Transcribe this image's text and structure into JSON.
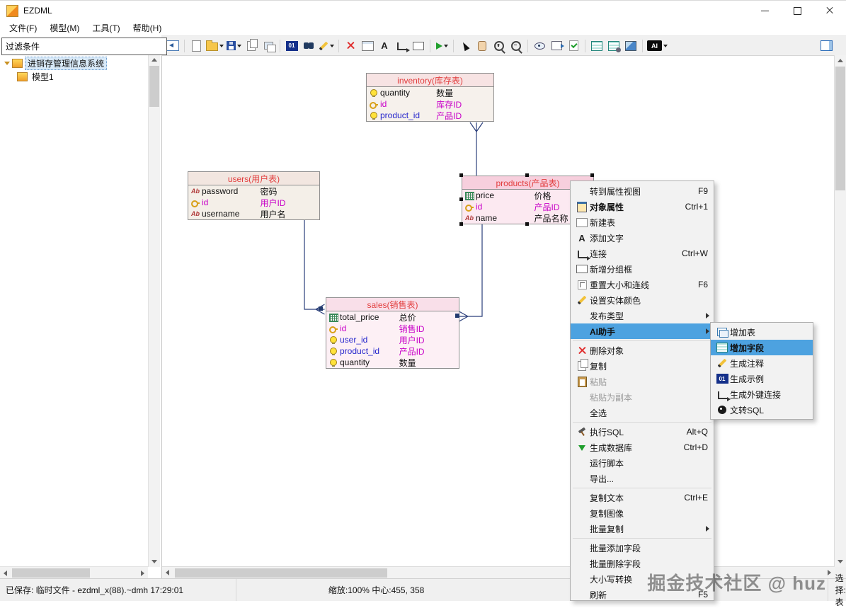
{
  "window": {
    "title": "EZDML"
  },
  "menubar": {
    "items": [
      "文件(F)",
      "模型(M)",
      "工具(T)",
      "帮助(H)"
    ]
  },
  "glyphs": {
    "binary": "01",
    "text_a": "A",
    "ai": "AI",
    "abc": "Ab"
  },
  "toolbar": {
    "icons": [
      "previous-diagram",
      "new-model",
      "open-model",
      "save-model",
      "copy-model",
      "cascade-windows",
      "binary-data",
      "find",
      "edit-color",
      "delete-selected",
      "new-table",
      "add-text",
      "add-connection",
      "add-group-box",
      "run",
      "select-pointer",
      "pan-hand",
      "zoom-in",
      "zoom-out",
      "preview",
      "export-model",
      "check-script",
      "model-grid",
      "model-grid-settings",
      "diagram-image",
      "ai-assistant",
      "panel-layout"
    ]
  },
  "sidebar": {
    "filter_value": "过滤条件",
    "tree_items": [
      "进销存管理信息系统",
      "模型1"
    ]
  },
  "diagram": {
    "tables": [
      {
        "title": "inventory(库存表)",
        "fields": [
          {
            "name": "quantity",
            "label": "数量",
            "icon": "bulb"
          },
          {
            "name": "id",
            "label": "库存ID",
            "icon": "key"
          },
          {
            "name": "product_id",
            "label": "产品ID",
            "icon": "bulb"
          }
        ]
      },
      {
        "title": "users(用户表)",
        "fields": [
          {
            "name": "password",
            "label": "密码",
            "icon": "abc"
          },
          {
            "name": "id",
            "label": "用户ID",
            "icon": "key"
          },
          {
            "name": "username",
            "label": "用户名",
            "icon": "abc"
          }
        ]
      },
      {
        "title": "products(产品表)",
        "fields": [
          {
            "name": "price",
            "label": "价格",
            "icon": "numeric"
          },
          {
            "name": "id",
            "label": "产品ID",
            "icon": "key"
          },
          {
            "name": "name",
            "label": "产品名称",
            "icon": "abc"
          }
        ]
      },
      {
        "title": "sales(销售表)",
        "fields": [
          {
            "name": "total_price",
            "label": "总价",
            "icon": "numeric"
          },
          {
            "name": "id",
            "label": "销售ID",
            "icon": "key"
          },
          {
            "name": "user_id",
            "label": "用户ID",
            "icon": "bulb"
          },
          {
            "name": "product_id",
            "label": "产品ID",
            "icon": "bulb"
          },
          {
            "name": "quantity",
            "label": "数量",
            "icon": "bulb"
          }
        ]
      }
    ]
  },
  "context_menu": {
    "items": [
      {
        "label": "转到属性视图",
        "shortcut": "F9"
      },
      {
        "label": "对象属性",
        "shortcut": "Ctrl+1"
      },
      {
        "label": "新建表",
        "shortcut": ""
      },
      {
        "label": "添加文字",
        "shortcut": ""
      },
      {
        "label": "连接",
        "shortcut": "Ctrl+W"
      },
      {
        "label": "新增分组框",
        "shortcut": ""
      },
      {
        "label": "重置大小和连线",
        "shortcut": "F6"
      },
      {
        "label": "设置实体颜色",
        "shortcut": ""
      },
      {
        "label": "发布类型",
        "shortcut": ""
      },
      {
        "label": "AI助手",
        "shortcut": ""
      },
      {
        "label": "删除对象",
        "shortcut": ""
      },
      {
        "label": "复制",
        "shortcut": ""
      },
      {
        "label": "粘贴",
        "shortcut": ""
      },
      {
        "label": "粘贴为副本",
        "shortcut": ""
      },
      {
        "label": "全选",
        "shortcut": ""
      },
      {
        "label": "执行SQL",
        "shortcut": "Alt+Q"
      },
      {
        "label": "生成数据库",
        "shortcut": "Ctrl+D"
      },
      {
        "label": "运行脚本",
        "shortcut": ""
      },
      {
        "label": "导出...",
        "shortcut": ""
      },
      {
        "label": "复制文本",
        "shortcut": "Ctrl+E"
      },
      {
        "label": "复制图像",
        "shortcut": ""
      },
      {
        "label": "批量复制",
        "shortcut": ""
      },
      {
        "label": "批量添加字段",
        "shortcut": ""
      },
      {
        "label": "批量删除字段",
        "shortcut": ""
      },
      {
        "label": "大小写转换",
        "shortcut": ""
      },
      {
        "label": "刷新",
        "shortcut": "F5"
      }
    ]
  },
  "ai_submenu": {
    "items": [
      {
        "label": "增加表"
      },
      {
        "label": "增加字段"
      },
      {
        "label": "生成注释"
      },
      {
        "label": "生成示例"
      },
      {
        "label": "生成外键连接"
      },
      {
        "label": "文转SQL"
      }
    ]
  },
  "statusbar": {
    "save_status": "已保存: 临时文件 - ezdml_x(88).~dmh 17:29:01",
    "zoom_center": "缩放:100% 中心:455, 358",
    "selection": "选择: 表"
  },
  "watermark": "掘金技术社区 @ huz",
  "colors": {
    "menu_highlight": "#4da2e0",
    "table_title": "#e23d3d",
    "primary_key": "#c800c8",
    "foreign_key": "#2626cc",
    "connection_line": "#2a3e7a"
  }
}
